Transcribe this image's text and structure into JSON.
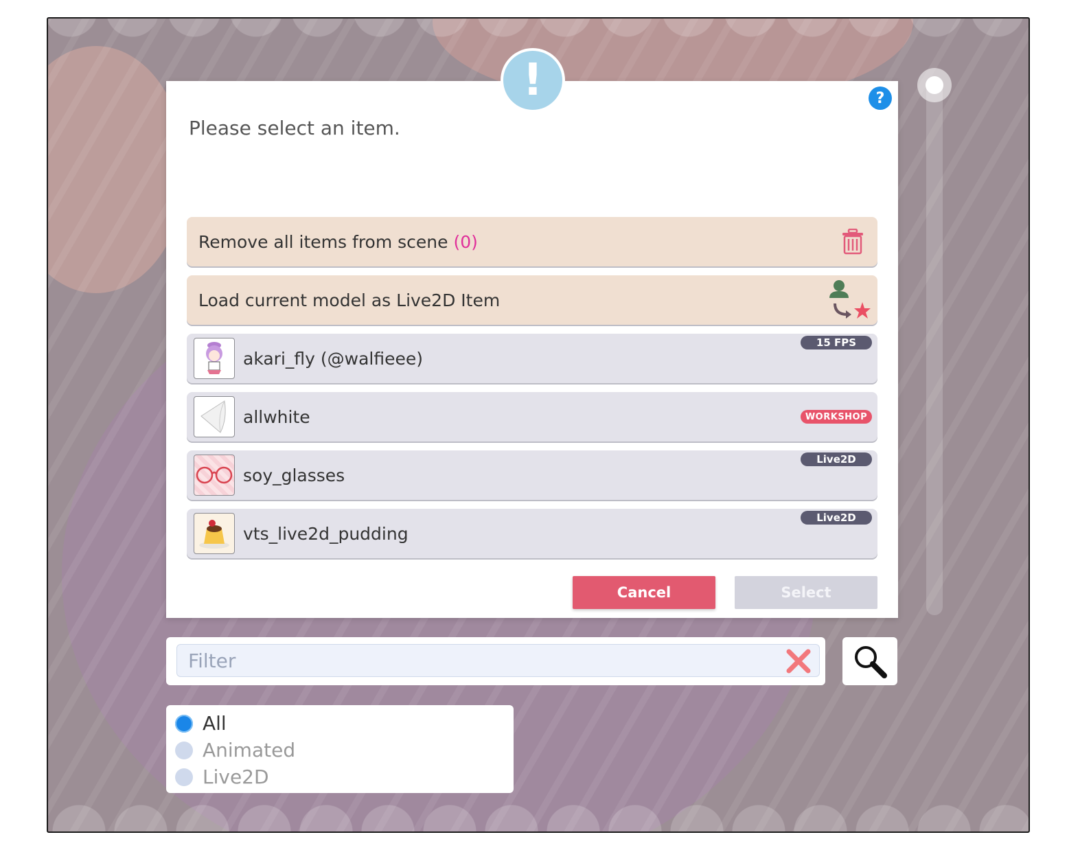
{
  "dialog": {
    "alert_glyph": "!",
    "help_glyph": "?",
    "title": "Please select an item."
  },
  "actions": [
    {
      "label": "Remove all items from scene",
      "count": "(0)",
      "icon": "trash-icon"
    },
    {
      "label": "Load current model as Live2D Item",
      "icon": "model-to-item-icon"
    }
  ],
  "items": [
    {
      "name": "akari_fly (@walfieee)",
      "badge": "15 FPS",
      "thumb": "chibi-character"
    },
    {
      "name": "allwhite",
      "badge": "WORKSHOP",
      "thumb": "white-cloth"
    },
    {
      "name": "soy_glasses",
      "badge": "Live2D",
      "thumb": "red-glasses"
    },
    {
      "name": "vts_live2d_pudding",
      "badge": "Live2D",
      "thumb": "pudding"
    }
  ],
  "buttons": {
    "cancel": "Cancel",
    "select": "Select"
  },
  "filter": {
    "placeholder": "Filter",
    "value": ""
  },
  "type_filter": {
    "options": [
      "All",
      "Animated",
      "Live2D"
    ],
    "selected": "All"
  },
  "colors": {
    "cancel": "#e25a70",
    "accent_blue": "#1e8fe8",
    "action_row": "#f0dfd1",
    "item_row": "#e3e2ea",
    "badge": "#5b5a70",
    "workshop_badge": "#e8536a",
    "count": "#e0309a"
  }
}
